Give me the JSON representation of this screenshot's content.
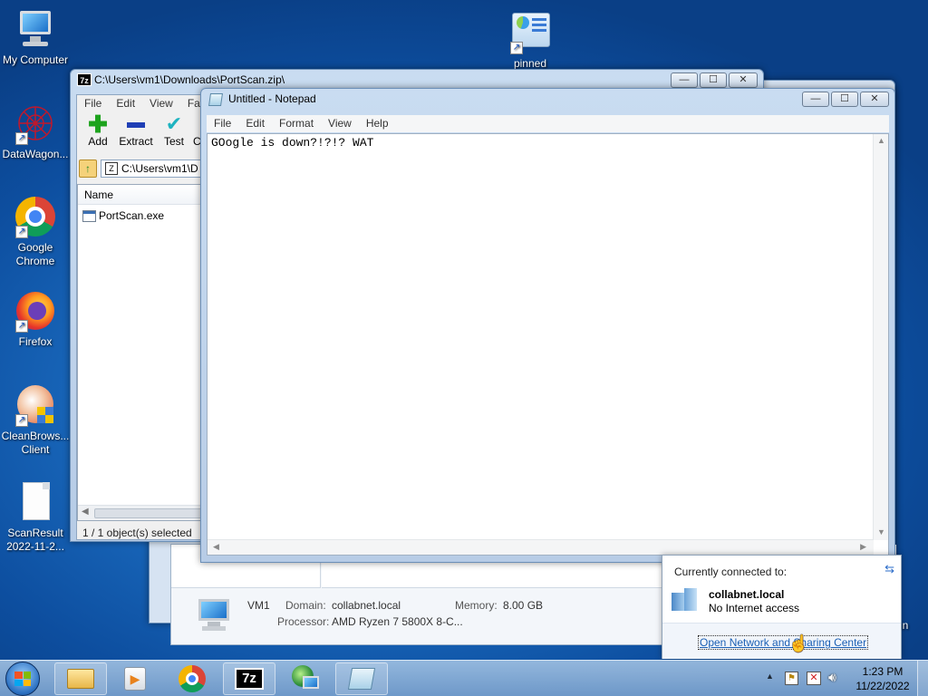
{
  "desktop": {
    "icons": [
      {
        "label": "My Computer",
        "icon": "computer-icon"
      },
      {
        "label": "DataWagon...",
        "icon": "datawagon-icon"
      },
      {
        "label": "Google Chrome",
        "icon": "chrome-icon"
      },
      {
        "label": "Firefox",
        "icon": "firefox-icon"
      },
      {
        "label": "CleanBrows... Client",
        "icon": "cleanbrowsing-icon"
      },
      {
        "label": "ScanResult 2022-11-2...",
        "icon": "file-icon"
      },
      {
        "label": "pinned",
        "icon": "control-panel-icon"
      }
    ]
  },
  "sevenzip": {
    "title": "C:\\Users\\vm1\\Downloads\\PortScan.zip\\",
    "menu": [
      "File",
      "Edit",
      "View",
      "Favo"
    ],
    "toolbar": [
      "Add",
      "Extract",
      "Test",
      "C"
    ],
    "address": "C:\\Users\\vm1\\D",
    "column_name": "Name",
    "files": [
      {
        "name": "PortScan.exe"
      }
    ],
    "status": "1 / 1 object(s) selected"
  },
  "notepad": {
    "title": "Untitled - Notepad",
    "menu": [
      "File",
      "Edit",
      "Format",
      "View",
      "Help"
    ],
    "content": "GOogle is down?!?!? WAT"
  },
  "system_window": {
    "computer_name": "VM1",
    "domain_label": "Domain:",
    "domain_value": "collabnet.local",
    "memory_label": "Memory:",
    "memory_value": "8.00 GB",
    "processor_label": "Processor:",
    "processor_value": "AMD Ryzen 7 5800X 8-C...",
    "partial_text": "in"
  },
  "network_popup": {
    "header": "Currently connected to:",
    "network_name": "collabnet.local",
    "network_status": "No Internet access",
    "link": "Open Network and Sharing Center"
  },
  "taskbar": {
    "time": "1:23 PM",
    "date": "11/22/2022",
    "apps": [
      "windows-explorer-icon",
      "media-player-icon",
      "chrome-icon",
      "7zip-icon",
      "network-icon",
      "notepad-icon"
    ]
  }
}
